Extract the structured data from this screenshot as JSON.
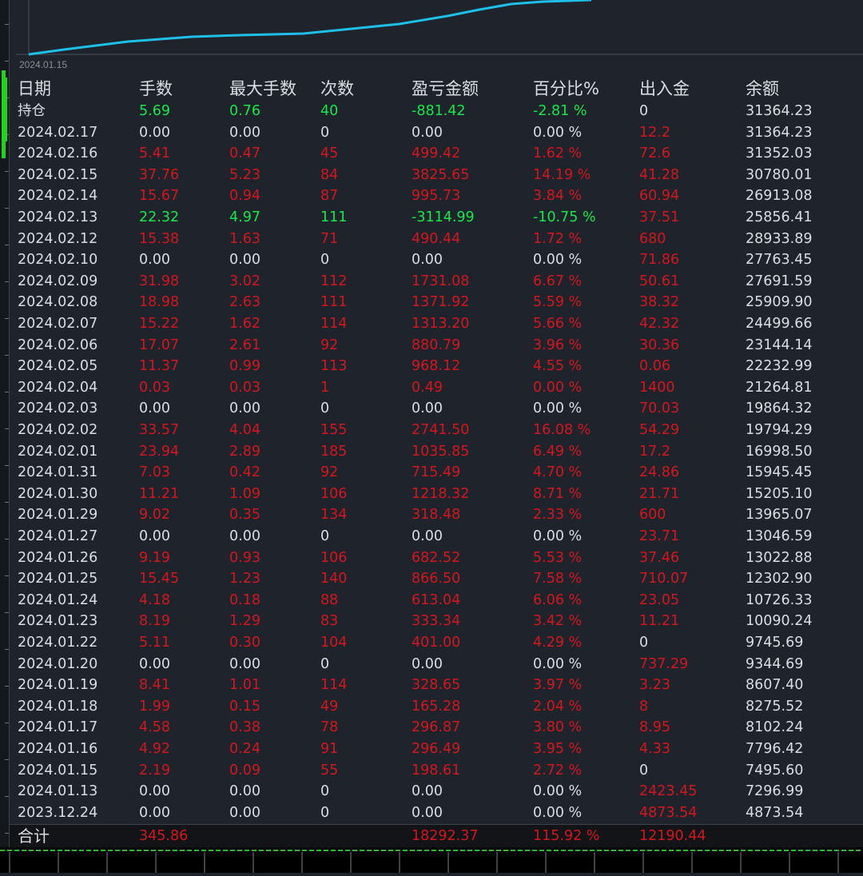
{
  "chart": {
    "date_label": "2024.01.15",
    "line_color": "#1ec0ea",
    "curve_points": [
      [
        36,
        68
      ],
      [
        80,
        62
      ],
      [
        160,
        52
      ],
      [
        240,
        46
      ],
      [
        300,
        44
      ],
      [
        380,
        42
      ],
      [
        440,
        36
      ],
      [
        500,
        30
      ],
      [
        560,
        20
      ],
      [
        600,
        12
      ],
      [
        640,
        5
      ],
      [
        680,
        2
      ],
      [
        740,
        0
      ]
    ]
  },
  "colors": {
    "background": "#1f232b",
    "white": "#dadde3",
    "red": "#d4161f",
    "green": "#17e84a"
  },
  "headers": [
    "日期",
    "手数",
    "最大手数",
    "次数",
    "盈亏金额",
    "百分比%",
    "出入金",
    "余额"
  ],
  "rows": [
    {
      "cells": [
        "持仓",
        "5.69",
        "0.76",
        "40",
        "-881.42",
        "-2.81 %",
        "0",
        "31364.23"
      ],
      "colors": [
        "w",
        "g",
        "g",
        "g",
        "g",
        "g",
        "w",
        "w"
      ]
    },
    {
      "cells": [
        "2024.02.17",
        "0.00",
        "0.00",
        "0",
        "0.00",
        "0.00 %",
        "12.2",
        "31364.23"
      ],
      "colors": [
        "w",
        "w",
        "w",
        "w",
        "w",
        "w",
        "r",
        "w"
      ]
    },
    {
      "cells": [
        "2024.02.16",
        "5.41",
        "0.47",
        "45",
        "499.42",
        "1.62 %",
        "72.6",
        "31352.03"
      ],
      "colors": [
        "w",
        "r",
        "r",
        "r",
        "r",
        "r",
        "r",
        "w"
      ]
    },
    {
      "cells": [
        "2024.02.15",
        "37.76",
        "5.23",
        "84",
        "3825.65",
        "14.19 %",
        "41.28",
        "30780.01"
      ],
      "colors": [
        "w",
        "r",
        "r",
        "r",
        "r",
        "r",
        "r",
        "w"
      ]
    },
    {
      "cells": [
        "2024.02.14",
        "15.67",
        "0.94",
        "87",
        "995.73",
        "3.84 %",
        "60.94",
        "26913.08"
      ],
      "colors": [
        "w",
        "r",
        "r",
        "r",
        "r",
        "r",
        "r",
        "w"
      ]
    },
    {
      "cells": [
        "2024.02.13",
        "22.32",
        "4.97",
        "111",
        "-3114.99",
        "-10.75 %",
        "37.51",
        "25856.41"
      ],
      "colors": [
        "w",
        "g",
        "g",
        "g",
        "g",
        "g",
        "r",
        "w"
      ]
    },
    {
      "cells": [
        "2024.02.12",
        "15.38",
        "1.63",
        "71",
        "490.44",
        "1.72 %",
        "680",
        "28933.89"
      ],
      "colors": [
        "w",
        "r",
        "r",
        "r",
        "r",
        "r",
        "r",
        "w"
      ]
    },
    {
      "cells": [
        "2024.02.10",
        "0.00",
        "0.00",
        "0",
        "0.00",
        "0.00 %",
        "71.86",
        "27763.45"
      ],
      "colors": [
        "w",
        "w",
        "w",
        "w",
        "w",
        "w",
        "r",
        "w"
      ]
    },
    {
      "cells": [
        "2024.02.09",
        "31.98",
        "3.02",
        "112",
        "1731.08",
        "6.67 %",
        "50.61",
        "27691.59"
      ],
      "colors": [
        "w",
        "r",
        "r",
        "r",
        "r",
        "r",
        "r",
        "w"
      ]
    },
    {
      "cells": [
        "2024.02.08",
        "18.98",
        "2.63",
        "111",
        "1371.92",
        "5.59 %",
        "38.32",
        "25909.90"
      ],
      "colors": [
        "w",
        "r",
        "r",
        "r",
        "r",
        "r",
        "r",
        "w"
      ]
    },
    {
      "cells": [
        "2024.02.07",
        "15.22",
        "1.62",
        "114",
        "1313.20",
        "5.66 %",
        "42.32",
        "24499.66"
      ],
      "colors": [
        "w",
        "r",
        "r",
        "r",
        "r",
        "r",
        "r",
        "w"
      ]
    },
    {
      "cells": [
        "2024.02.06",
        "17.07",
        "2.61",
        "92",
        "880.79",
        "3.96 %",
        "30.36",
        "23144.14"
      ],
      "colors": [
        "w",
        "r",
        "r",
        "r",
        "r",
        "r",
        "r",
        "w"
      ]
    },
    {
      "cells": [
        "2024.02.05",
        "11.37",
        "0.99",
        "113",
        "968.12",
        "4.55 %",
        "0.06",
        "22232.99"
      ],
      "colors": [
        "w",
        "r",
        "r",
        "r",
        "r",
        "r",
        "r",
        "w"
      ]
    },
    {
      "cells": [
        "2024.02.04",
        "0.03",
        "0.03",
        "1",
        "0.49",
        "0.00 %",
        "1400",
        "21264.81"
      ],
      "colors": [
        "w",
        "r",
        "r",
        "r",
        "r",
        "r",
        "r",
        "w"
      ]
    },
    {
      "cells": [
        "2024.02.03",
        "0.00",
        "0.00",
        "0",
        "0.00",
        "0.00 %",
        "70.03",
        "19864.32"
      ],
      "colors": [
        "w",
        "w",
        "w",
        "w",
        "w",
        "w",
        "r",
        "w"
      ]
    },
    {
      "cells": [
        "2024.02.02",
        "33.57",
        "4.04",
        "155",
        "2741.50",
        "16.08 %",
        "54.29",
        "19794.29"
      ],
      "colors": [
        "w",
        "r",
        "r",
        "r",
        "r",
        "r",
        "r",
        "w"
      ]
    },
    {
      "cells": [
        "2024.02.01",
        "23.94",
        "2.89",
        "185",
        "1035.85",
        "6.49 %",
        "17.2",
        "16998.50"
      ],
      "colors": [
        "w",
        "r",
        "r",
        "r",
        "r",
        "r",
        "r",
        "w"
      ]
    },
    {
      "cells": [
        "2024.01.31",
        "7.03",
        "0.42",
        "92",
        "715.49",
        "4.70 %",
        "24.86",
        "15945.45"
      ],
      "colors": [
        "w",
        "r",
        "r",
        "r",
        "r",
        "r",
        "r",
        "w"
      ]
    },
    {
      "cells": [
        "2024.01.30",
        "11.21",
        "1.09",
        "106",
        "1218.32",
        "8.71 %",
        "21.71",
        "15205.10"
      ],
      "colors": [
        "w",
        "r",
        "r",
        "r",
        "r",
        "r",
        "r",
        "w"
      ]
    },
    {
      "cells": [
        "2024.01.29",
        "9.02",
        "0.35",
        "134",
        "318.48",
        "2.33 %",
        "600",
        "13965.07"
      ],
      "colors": [
        "w",
        "r",
        "r",
        "r",
        "r",
        "r",
        "r",
        "w"
      ]
    },
    {
      "cells": [
        "2024.01.27",
        "0.00",
        "0.00",
        "0",
        "0.00",
        "0.00 %",
        "23.71",
        "13046.59"
      ],
      "colors": [
        "w",
        "w",
        "w",
        "w",
        "w",
        "w",
        "r",
        "w"
      ]
    },
    {
      "cells": [
        "2024.01.26",
        "9.19",
        "0.93",
        "106",
        "682.52",
        "5.53 %",
        "37.46",
        "13022.88"
      ],
      "colors": [
        "w",
        "r",
        "r",
        "r",
        "r",
        "r",
        "r",
        "w"
      ]
    },
    {
      "cells": [
        "2024.01.25",
        "15.45",
        "1.23",
        "140",
        "866.50",
        "7.58 %",
        "710.07",
        "12302.90"
      ],
      "colors": [
        "w",
        "r",
        "r",
        "r",
        "r",
        "r",
        "r",
        "w"
      ]
    },
    {
      "cells": [
        "2024.01.24",
        "4.18",
        "0.18",
        "88",
        "613.04",
        "6.06 %",
        "23.05",
        "10726.33"
      ],
      "colors": [
        "w",
        "r",
        "r",
        "r",
        "r",
        "r",
        "r",
        "w"
      ]
    },
    {
      "cells": [
        "2024.01.23",
        "8.19",
        "1.29",
        "83",
        "333.34",
        "3.42 %",
        "11.21",
        "10090.24"
      ],
      "colors": [
        "w",
        "r",
        "r",
        "r",
        "r",
        "r",
        "r",
        "w"
      ]
    },
    {
      "cells": [
        "2024.01.22",
        "5.11",
        "0.30",
        "104",
        "401.00",
        "4.29 %",
        "0",
        "9745.69"
      ],
      "colors": [
        "w",
        "r",
        "r",
        "r",
        "r",
        "r",
        "w",
        "w"
      ]
    },
    {
      "cells": [
        "2024.01.20",
        "0.00",
        "0.00",
        "0",
        "0.00",
        "0.00 %",
        "737.29",
        "9344.69"
      ],
      "colors": [
        "w",
        "w",
        "w",
        "w",
        "w",
        "w",
        "r",
        "w"
      ]
    },
    {
      "cells": [
        "2024.01.19",
        "8.41",
        "1.01",
        "114",
        "328.65",
        "3.97 %",
        "3.23",
        "8607.40"
      ],
      "colors": [
        "w",
        "r",
        "r",
        "r",
        "r",
        "r",
        "r",
        "w"
      ]
    },
    {
      "cells": [
        "2024.01.18",
        "1.99",
        "0.15",
        "49",
        "165.28",
        "2.04 %",
        "8",
        "8275.52"
      ],
      "colors": [
        "w",
        "r",
        "r",
        "r",
        "r",
        "r",
        "r",
        "w"
      ]
    },
    {
      "cells": [
        "2024.01.17",
        "4.58",
        "0.38",
        "78",
        "296.87",
        "3.80 %",
        "8.95",
        "8102.24"
      ],
      "colors": [
        "w",
        "r",
        "r",
        "r",
        "r",
        "r",
        "r",
        "w"
      ]
    },
    {
      "cells": [
        "2024.01.16",
        "4.92",
        "0.24",
        "91",
        "296.49",
        "3.95 %",
        "4.33",
        "7796.42"
      ],
      "colors": [
        "w",
        "r",
        "r",
        "r",
        "r",
        "r",
        "r",
        "w"
      ]
    },
    {
      "cells": [
        "2024.01.15",
        "2.19",
        "0.09",
        "55",
        "198.61",
        "2.72 %",
        "0",
        "7495.60"
      ],
      "colors": [
        "w",
        "r",
        "r",
        "r",
        "r",
        "r",
        "w",
        "w"
      ]
    },
    {
      "cells": [
        "2024.01.13",
        "0.00",
        "0.00",
        "0",
        "0.00",
        "0.00 %",
        "2423.45",
        "7296.99"
      ],
      "colors": [
        "w",
        "w",
        "w",
        "w",
        "w",
        "w",
        "r",
        "w"
      ]
    },
    {
      "cells": [
        "2023.12.24",
        "0.00",
        "0.00",
        "0",
        "0.00",
        "0.00 %",
        "4873.54",
        "4873.54"
      ],
      "colors": [
        "w",
        "w",
        "w",
        "w",
        "w",
        "w",
        "r",
        "w"
      ]
    }
  ],
  "footer": {
    "label": "合计",
    "lots": "345.86",
    "profit": "18292.37",
    "percent": "115.92 %",
    "deposit": "12190.44"
  }
}
